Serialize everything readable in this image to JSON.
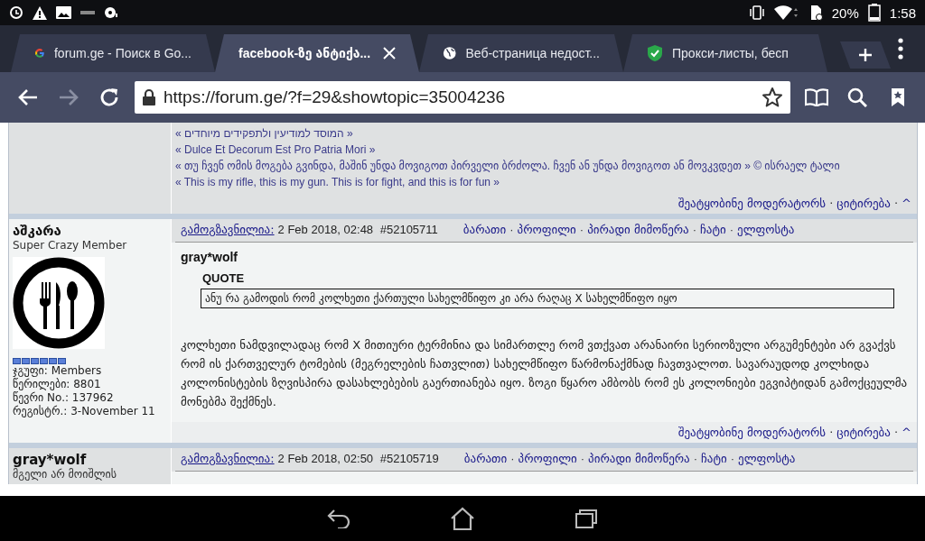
{
  "status_bar": {
    "battery": "20%",
    "time": "1:58"
  },
  "tabs": [
    {
      "title": "forum.ge - Поиск в Go...",
      "selected": false
    },
    {
      "title": "facebook-ზე ანტიქა...",
      "selected": true
    },
    {
      "title": "Веб-страница недост...",
      "selected": false
    },
    {
      "title": "Прокси-листы, бесп",
      "selected": false
    }
  ],
  "address_bar": {
    "url": "https://forum.ge/?f=29&showtopic=35004236"
  },
  "previous_post": {
    "signature": [
      "« המוסד למודיעין ולתפקידים מיוחדים »",
      "« Dulce Et Decorum Est Pro Patria Mori »",
      "« თუ ჩვენ ომის მოგება გვინდა, მაშინ უნდა მოვიგოთ პირველი ბრძოლა. ჩვენ ან უნდა მოვიგოთ ან მოვკვდეთ » © ისრაელ ტალი",
      "« This is my rifle, this is my gun. This is for fight, and this is for fun »"
    ],
    "footer_links": [
      "შეატყობინე მოდერატორს",
      "ციტირება",
      "^"
    ]
  },
  "separator": "·",
  "posts": [
    {
      "author": "აშკარა",
      "rank": "Super Crazy Member",
      "avatar": true,
      "stars": 6,
      "stats": [
        "ჯგუფი: Members",
        "წერილები: 8801",
        "წევრი No.: 137962",
        "რეგისტრ.: 3-November 11"
      ],
      "posted_label": "გამოგზავნილია:",
      "date": "2 Feb 2018, 02:48",
      "post_number": "#52105711",
      "header_links": [
        "ბარათი",
        "პროფილი",
        "პირადი მიმოწერა",
        "ჩატი",
        "ელფოსტა"
      ],
      "quote_author": "gray*wolf",
      "quote_label": "QUOTE",
      "quote_text": "ანუ რა გამოდის რომ კოლხეთი ქართული სახელმწიფო კი არა რაღაც X სახელმწიფო იყო",
      "text": "კოლხეთი ნამდვილადაც რომ X მითიური ტერმინია და სიმართლე რომ ვთქვათ არანაირი სერიოზული არგუმენტები არ გვაქვს რომ ის ქართველურ ტომების (მეგრელების ჩათვლით) სახელმწიფო წარმონაქმნად ჩავთვალოთ. სავარაუდოდ კოლხიდა კოლონისტების ზღვისპირა დასახლებების გაერთიანება იყო. ზოგი წყარო ამბობს რომ ეს კოლონიები ეგვიპტიდან გამოქცეულმა მონებმა შექმნეს.",
      "footer_links": [
        "შეატყობინე მოდერატორს",
        "ციტირება",
        "^"
      ]
    },
    {
      "author": "gray*wolf",
      "rank": "მგელი არ მოიშლის",
      "posted_label": "გამოგზავნილია:",
      "date": "2 Feb 2018, 02:50",
      "post_number": "#52105719",
      "header_links": [
        "ბარათი",
        "პროფილი",
        "პირადი მიმოწერა",
        "ჩატი",
        "ელფოსტა"
      ]
    }
  ]
}
